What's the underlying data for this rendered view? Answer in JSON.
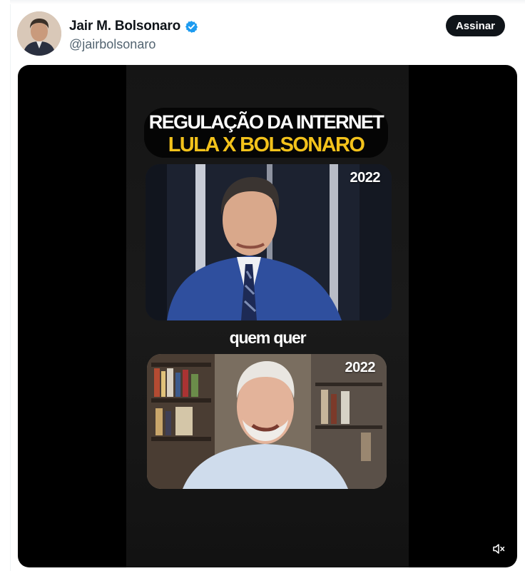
{
  "post": {
    "author_name": "Jair M. Bolsonaro",
    "handle": "@jairbolsonaro",
    "subscribe_label": "Assinar",
    "verified_icon": "verified-badge-icon",
    "verified_color": "#1d9bf0"
  },
  "video": {
    "title_line1": "REGULAÇÃO DA INTERNET",
    "title_line2": "LULA X BOLSONARO",
    "title_line2_color": "#f3c21b",
    "top_year": "2022",
    "caption": "quem quer",
    "bottom_year": "2022",
    "mute_icon": "speaker-muted-icon"
  }
}
